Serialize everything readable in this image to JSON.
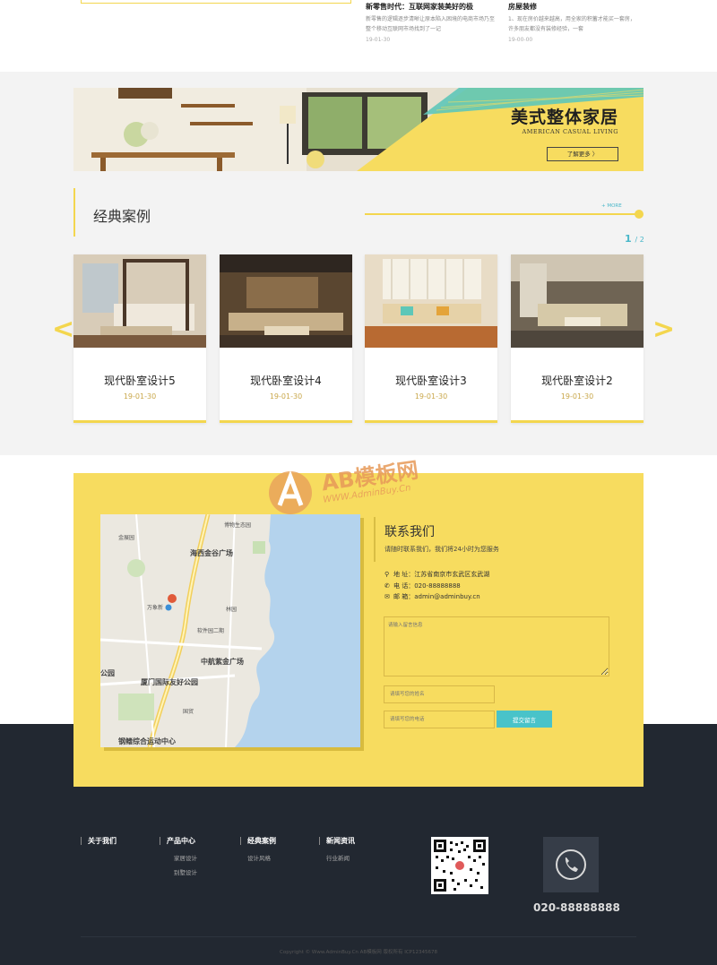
{
  "news": [
    {
      "title": "新零售时代：互联网家装美好的极",
      "desc": "新零售的逻辑逐步清晰让原本陷入困境的电商市场乃至整个移动互联网市场找到了一记",
      "date": "19-01-30"
    },
    {
      "title": "房屋装修",
      "desc": "1、现在房价越来越高，用全家的积蓄才能买一套房，许多朋友都没有装修经验，一套",
      "date": "19-00-00"
    }
  ],
  "banner": {
    "title": "美式整体家居",
    "subtitle": "AMERICAN CASUAL LIVING",
    "button": "了解更多 〉"
  },
  "cases": {
    "title": "经典案例",
    "more": "+ MORE",
    "pager_current": "1",
    "pager_total": "/ 2",
    "prev": "<",
    "next": ">",
    "items": [
      {
        "name": "现代卧室设计5",
        "date": "19-01-30"
      },
      {
        "name": "现代卧室设计4",
        "date": "19-01-30"
      },
      {
        "name": "现代卧室设计3",
        "date": "19-01-30"
      },
      {
        "name": "现代卧室设计2",
        "date": "19-01-30"
      }
    ]
  },
  "contact": {
    "title": "联系我们",
    "subtitle": "请随时联系我们，我们将24小时为您服务",
    "address": "地 址：江苏省南京市玄武区玄武湖",
    "phone": "电 话：020-88888888",
    "email": "邮 箱：admin@adminbuy.cn",
    "message_placeholder": "请输入留言信息",
    "name_placeholder": "请填写您的姓名",
    "phone_placeholder": "请填写您的电话",
    "submit": "提交留言",
    "map_labels": [
      "海西金谷广场",
      "中航紫金广场",
      "厦门国际友好公园",
      "钢鳍综合运动中心",
      "万象新",
      "软件园二期",
      "公园",
      "金展园",
      "博物生态园",
      "国贸",
      "林园"
    ]
  },
  "watermark": {
    "main": "AB模板网",
    "sub": "WWW.AdminBuy.Cn"
  },
  "footer": {
    "cols": [
      {
        "head": "关于我们",
        "links": []
      },
      {
        "head": "产品中心",
        "links": [
          "家居设计",
          "别墅设计"
        ]
      },
      {
        "head": "经典案例",
        "links": [
          "设计风格"
        ]
      },
      {
        "head": "新闻资讯",
        "links": [
          "行业新闻"
        ]
      }
    ],
    "phone": "020-88888888",
    "copyright": "Copyright © Www.AdminBuy.Cn AB模板网 版权所有  ICP12345678"
  },
  "colors": {
    "accent": "#f3d64e",
    "teal": "#49c3c9",
    "dark": "#222831"
  }
}
